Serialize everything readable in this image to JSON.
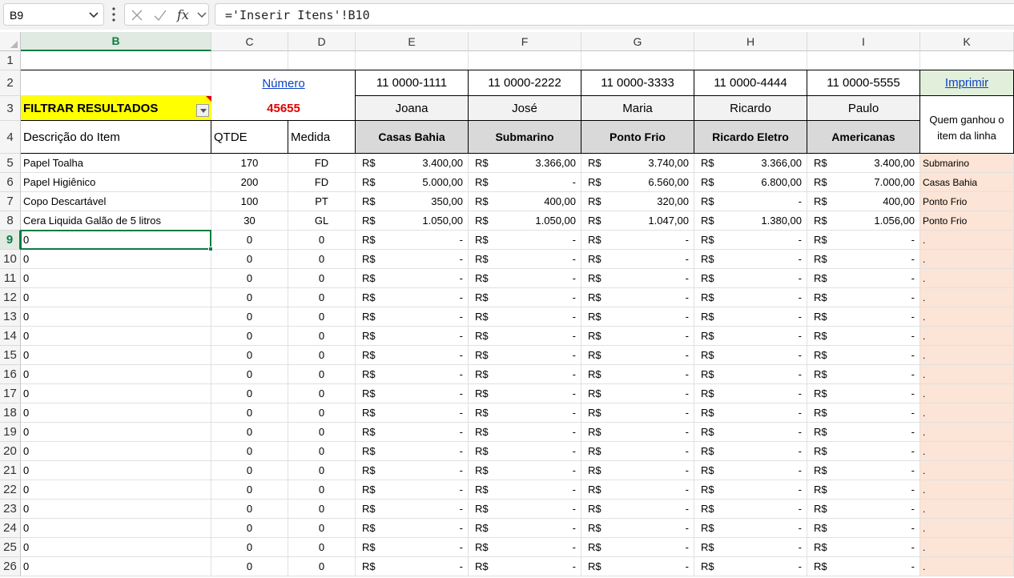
{
  "formula_bar": {
    "name_box": "B9",
    "formula": "='Inserir Itens'!B10"
  },
  "columns": [
    "B",
    "C",
    "D",
    "E",
    "F",
    "G",
    "H",
    "I",
    "K"
  ],
  "selected_cell": "B9",
  "header": {
    "numero_label": "Número",
    "numero_value": "45655",
    "filtrar_label": "FILTRAR RESULTADOS",
    "imprimir_label": "Imprimir",
    "winner_caption": "Quem ganhou o item da linha",
    "item_cols": [
      "Descrição do Item",
      "QTDE",
      "Medida"
    ],
    "phones": [
      "11 0000-1111",
      "11 0000-2222",
      "11 0000-3333",
      "11 0000-4444",
      "11 0000-5555"
    ],
    "persons": [
      "Joana",
      "José",
      "Maria",
      "Ricardo",
      "Paulo"
    ],
    "stores": [
      "Casas Bahia",
      "Submarino",
      "Ponto Frio",
      "Ricardo Eletro",
      "Americanas"
    ]
  },
  "currency_symbol": "R$",
  "items": [
    {
      "row": "5",
      "desc": "Papel Toalha",
      "qtde": "170",
      "medida": "FD",
      "prices": [
        "3.400,00",
        "3.366,00",
        "3.740,00",
        "3.366,00",
        "3.400,00"
      ],
      "winner": "Submarino"
    },
    {
      "row": "6",
      "desc": "Papel Higiênico",
      "qtde": "200",
      "medida": "FD",
      "prices": [
        "5.000,00",
        "-",
        "6.560,00",
        "6.800,00",
        "7.000,00"
      ],
      "winner": "Casas Bahia"
    },
    {
      "row": "7",
      "desc": "Copo Descartável",
      "qtde": "100",
      "medida": "PT",
      "prices": [
        "350,00",
        "400,00",
        "320,00",
        "-",
        "400,00"
      ],
      "winner": "Ponto Frio"
    },
    {
      "row": "8",
      "desc": "Cera Liquida Galão de 5 litros",
      "qtde": "30",
      "medida": "GL",
      "prices": [
        "1.050,00",
        "1.050,00",
        "1.047,00",
        "1.380,00",
        "1.056,00"
      ],
      "winner": "Ponto Frio"
    },
    {
      "row": "9",
      "desc": "0",
      "qtde": "0",
      "medida": "0",
      "prices": [
        "-",
        "-",
        "-",
        "-",
        "-"
      ],
      "winner": "."
    },
    {
      "row": "10",
      "desc": "0",
      "qtde": "0",
      "medida": "0",
      "prices": [
        "-",
        "-",
        "-",
        "-",
        "-"
      ],
      "winner": "."
    },
    {
      "row": "11",
      "desc": "0",
      "qtde": "0",
      "medida": "0",
      "prices": [
        "-",
        "-",
        "-",
        "-",
        "-"
      ],
      "winner": "."
    },
    {
      "row": "12",
      "desc": "0",
      "qtde": "0",
      "medida": "0",
      "prices": [
        "-",
        "-",
        "-",
        "-",
        "-"
      ],
      "winner": "."
    },
    {
      "row": "13",
      "desc": "0",
      "qtde": "0",
      "medida": "0",
      "prices": [
        "-",
        "-",
        "-",
        "-",
        "-"
      ],
      "winner": "."
    },
    {
      "row": "14",
      "desc": "0",
      "qtde": "0",
      "medida": "0",
      "prices": [
        "-",
        "-",
        "-",
        "-",
        "-"
      ],
      "winner": "."
    },
    {
      "row": "15",
      "desc": "0",
      "qtde": "0",
      "medida": "0",
      "prices": [
        "-",
        "-",
        "-",
        "-",
        "-"
      ],
      "winner": "."
    },
    {
      "row": "16",
      "desc": "0",
      "qtde": "0",
      "medida": "0",
      "prices": [
        "-",
        "-",
        "-",
        "-",
        "-"
      ],
      "winner": "."
    },
    {
      "row": "17",
      "desc": "0",
      "qtde": "0",
      "medida": "0",
      "prices": [
        "-",
        "-",
        "-",
        "-",
        "-"
      ],
      "winner": "."
    },
    {
      "row": "18",
      "desc": "0",
      "qtde": "0",
      "medida": "0",
      "prices": [
        "-",
        "-",
        "-",
        "-",
        "-"
      ],
      "winner": "."
    },
    {
      "row": "19",
      "desc": "0",
      "qtde": "0",
      "medida": "0",
      "prices": [
        "-",
        "-",
        "-",
        "-",
        "-"
      ],
      "winner": "."
    },
    {
      "row": "20",
      "desc": "0",
      "qtde": "0",
      "medida": "0",
      "prices": [
        "-",
        "-",
        "-",
        "-",
        "-"
      ],
      "winner": "."
    },
    {
      "row": "21",
      "desc": "0",
      "qtde": "0",
      "medida": "0",
      "prices": [
        "-",
        "-",
        "-",
        "-",
        "-"
      ],
      "winner": "."
    },
    {
      "row": "22",
      "desc": "0",
      "qtde": "0",
      "medida": "0",
      "prices": [
        "-",
        "-",
        "-",
        "-",
        "-"
      ],
      "winner": "."
    },
    {
      "row": "23",
      "desc": "0",
      "qtde": "0",
      "medida": "0",
      "prices": [
        "-",
        "-",
        "-",
        "-",
        "-"
      ],
      "winner": "."
    },
    {
      "row": "24",
      "desc": "0",
      "qtde": "0",
      "medida": "0",
      "prices": [
        "-",
        "-",
        "-",
        "-",
        "-"
      ],
      "winner": "."
    },
    {
      "row": "25",
      "desc": "0",
      "qtde": "0",
      "medida": "0",
      "prices": [
        "-",
        "-",
        "-",
        "-",
        "-"
      ],
      "winner": "."
    },
    {
      "row": "26",
      "desc": "0",
      "qtde": "0",
      "medida": "0",
      "prices": [
        "-",
        "-",
        "-",
        "-",
        "-"
      ],
      "winner": "."
    }
  ],
  "row_headers": [
    "1",
    "2",
    "3",
    "4"
  ],
  "colors": {
    "filtrar_bg": "#ffff00",
    "winner_bg": "#fce4d6",
    "imprimir_bg": "#e2efda",
    "numero_value": "#e00000",
    "selection": "#107c41"
  }
}
